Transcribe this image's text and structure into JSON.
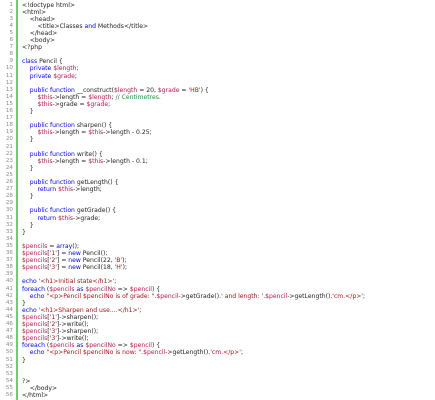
{
  "editor": {
    "lines": [
      {
        "n": "1",
        "parts": [
          [
            "t",
            "<!doctype html>"
          ]
        ]
      },
      {
        "n": "2",
        "parts": [
          [
            "t",
            "<html>"
          ]
        ]
      },
      {
        "n": "3",
        "parts": [
          [
            "t",
            "    <head>"
          ]
        ]
      },
      {
        "n": "4",
        "parts": [
          [
            "t",
            "        <title>Classes "
          ],
          [
            "kw",
            "and"
          ],
          [
            "t",
            " Methods</title>"
          ]
        ]
      },
      {
        "n": "5",
        "parts": [
          [
            "t",
            "    </head>"
          ]
        ]
      },
      {
        "n": "6",
        "parts": [
          [
            "t",
            "    <body>"
          ]
        ]
      },
      {
        "n": "7",
        "parts": [
          [
            "t",
            "<?php"
          ]
        ]
      },
      {
        "n": "8",
        "parts": []
      },
      {
        "n": "9",
        "parts": [
          [
            "kw",
            "class"
          ],
          [
            "t",
            " Pencil {"
          ]
        ]
      },
      {
        "n": "10",
        "parts": [
          [
            "t",
            "    "
          ],
          [
            "kw",
            "private"
          ],
          [
            "t",
            " "
          ],
          [
            "var",
            "$length"
          ],
          [
            "t",
            ";"
          ]
        ]
      },
      {
        "n": "11",
        "parts": [
          [
            "t",
            "    "
          ],
          [
            "kw",
            "private"
          ],
          [
            "t",
            " "
          ],
          [
            "var",
            "$grade"
          ],
          [
            "t",
            ";"
          ]
        ]
      },
      {
        "n": "12",
        "parts": []
      },
      {
        "n": "13",
        "parts": [
          [
            "t",
            "    "
          ],
          [
            "kw",
            "public function"
          ],
          [
            "t",
            " __construct("
          ],
          [
            "var",
            "$length"
          ],
          [
            "t",
            " = 20, "
          ],
          [
            "var",
            "$grade"
          ],
          [
            "t",
            " = "
          ],
          [
            "str",
            "'HB'"
          ],
          [
            "t",
            ") {"
          ]
        ]
      },
      {
        "n": "14",
        "parts": [
          [
            "t",
            "        "
          ],
          [
            "var",
            "$this"
          ],
          [
            "t",
            "->length = "
          ],
          [
            "var",
            "$length"
          ],
          [
            "t",
            "; "
          ],
          [
            "cm",
            "// Centimetres."
          ]
        ]
      },
      {
        "n": "15",
        "parts": [
          [
            "t",
            "        "
          ],
          [
            "var",
            "$this"
          ],
          [
            "t",
            "->grade = "
          ],
          [
            "var",
            "$grade"
          ],
          [
            "t",
            ";"
          ]
        ]
      },
      {
        "n": "16",
        "parts": [
          [
            "t",
            "    }"
          ]
        ]
      },
      {
        "n": "17",
        "parts": []
      },
      {
        "n": "18",
        "parts": [
          [
            "t",
            "    "
          ],
          [
            "kw",
            "public function"
          ],
          [
            "t",
            " sharpen() {"
          ]
        ]
      },
      {
        "n": "19",
        "parts": [
          [
            "t",
            "        "
          ],
          [
            "var",
            "$this"
          ],
          [
            "t",
            "->length = "
          ],
          [
            "var",
            "$this"
          ],
          [
            "t",
            "->length - 0.25;"
          ]
        ]
      },
      {
        "n": "20",
        "parts": [
          [
            "t",
            "    }"
          ]
        ]
      },
      {
        "n": "21",
        "parts": []
      },
      {
        "n": "22",
        "parts": [
          [
            "t",
            "    "
          ],
          [
            "kw",
            "public function"
          ],
          [
            "t",
            " write() {"
          ]
        ]
      },
      {
        "n": "23",
        "parts": [
          [
            "t",
            "        "
          ],
          [
            "var",
            "$this"
          ],
          [
            "t",
            "->length = "
          ],
          [
            "var",
            "$this"
          ],
          [
            "t",
            "->length - 0.1;"
          ]
        ]
      },
      {
        "n": "24",
        "parts": [
          [
            "t",
            "    }"
          ]
        ]
      },
      {
        "n": "25",
        "parts": []
      },
      {
        "n": "26",
        "parts": [
          [
            "t",
            "    "
          ],
          [
            "kw",
            "public function"
          ],
          [
            "t",
            " getLength() {"
          ]
        ]
      },
      {
        "n": "27",
        "parts": [
          [
            "t",
            "        "
          ],
          [
            "kw",
            "return"
          ],
          [
            "t",
            " "
          ],
          [
            "var",
            "$this"
          ],
          [
            "t",
            "->length;"
          ]
        ]
      },
      {
        "n": "28",
        "parts": [
          [
            "t",
            "    }"
          ]
        ]
      },
      {
        "n": "29",
        "parts": []
      },
      {
        "n": "30",
        "parts": [
          [
            "t",
            "    "
          ],
          [
            "kw",
            "public function"
          ],
          [
            "t",
            " getGrade() {"
          ]
        ]
      },
      {
        "n": "31",
        "parts": [
          [
            "t",
            "        "
          ],
          [
            "kw",
            "return"
          ],
          [
            "t",
            " "
          ],
          [
            "var",
            "$this"
          ],
          [
            "t",
            "->grade;"
          ]
        ]
      },
      {
        "n": "32",
        "parts": [
          [
            "t",
            "    }"
          ]
        ]
      },
      {
        "n": "33",
        "parts": [
          [
            "t",
            "}"
          ]
        ]
      },
      {
        "n": "34",
        "parts": []
      },
      {
        "n": "35",
        "parts": [
          [
            "var",
            "$pencils"
          ],
          [
            "t",
            " = "
          ],
          [
            "kw",
            "array"
          ],
          [
            "t",
            "();"
          ]
        ]
      },
      {
        "n": "36",
        "parts": [
          [
            "var",
            "$pencils"
          ],
          [
            "t",
            "["
          ],
          [
            "str",
            "'1'"
          ],
          [
            "t",
            "] = "
          ],
          [
            "kw",
            "new"
          ],
          [
            "t",
            " Pencil();"
          ]
        ]
      },
      {
        "n": "37",
        "parts": [
          [
            "var",
            "$pencils"
          ],
          [
            "t",
            "["
          ],
          [
            "str",
            "'2'"
          ],
          [
            "t",
            "] = "
          ],
          [
            "kw",
            "new"
          ],
          [
            "t",
            " Pencil(22, "
          ],
          [
            "str",
            "'B'"
          ],
          [
            "t",
            ");"
          ]
        ]
      },
      {
        "n": "38",
        "parts": [
          [
            "var",
            "$pencils"
          ],
          [
            "t",
            "["
          ],
          [
            "str",
            "'3'"
          ],
          [
            "t",
            "] = "
          ],
          [
            "kw",
            "new"
          ],
          [
            "t",
            " Pencil(18, "
          ],
          [
            "str",
            "'H'"
          ],
          [
            "t",
            ");"
          ]
        ]
      },
      {
        "n": "39",
        "parts": []
      },
      {
        "n": "40",
        "parts": [
          [
            "kw",
            "echo"
          ],
          [
            "t",
            " "
          ],
          [
            "str",
            "'<h1>Initial state</h1>'"
          ],
          [
            "t",
            ";"
          ]
        ]
      },
      {
        "n": "41",
        "parts": [
          [
            "kw",
            "foreach"
          ],
          [
            "t",
            " ("
          ],
          [
            "var",
            "$pencils"
          ],
          [
            "t",
            " "
          ],
          [
            "kw",
            "as"
          ],
          [
            "t",
            " "
          ],
          [
            "var",
            "$pencilNo"
          ],
          [
            "t",
            " => "
          ],
          [
            "var",
            "$pencil"
          ],
          [
            "t",
            ") {"
          ]
        ]
      },
      {
        "n": "42",
        "parts": [
          [
            "t",
            "    "
          ],
          [
            "kw",
            "echo"
          ],
          [
            "t",
            " "
          ],
          [
            "str",
            "\"<p>Pencil $pencilNo is of grade: \""
          ],
          [
            "t",
            "."
          ],
          [
            "var",
            "$pencil"
          ],
          [
            "t",
            "->getGrade()."
          ],
          [
            "str",
            "' and length: '"
          ],
          [
            "t",
            "."
          ],
          [
            "var",
            "$pencil"
          ],
          [
            "t",
            "->getLength()."
          ],
          [
            "str",
            "'cm.</p>'"
          ],
          [
            "t",
            ";"
          ]
        ]
      },
      {
        "n": "43",
        "parts": [
          [
            "t",
            "}"
          ]
        ]
      },
      {
        "n": "44",
        "parts": [
          [
            "kw",
            "echo"
          ],
          [
            "t",
            " "
          ],
          [
            "str",
            "'<h1>Sharpen and use....</h1>'"
          ],
          [
            "t",
            ";"
          ]
        ]
      },
      {
        "n": "45",
        "parts": [
          [
            "var",
            "$pencils"
          ],
          [
            "t",
            "["
          ],
          [
            "str",
            "'1'"
          ],
          [
            "t",
            "]->sharpen();"
          ]
        ]
      },
      {
        "n": "46",
        "parts": [
          [
            "var",
            "$pencils"
          ],
          [
            "t",
            "["
          ],
          [
            "str",
            "'2'"
          ],
          [
            "t",
            "]->write();"
          ]
        ]
      },
      {
        "n": "47",
        "parts": [
          [
            "var",
            "$pencils"
          ],
          [
            "t",
            "["
          ],
          [
            "str",
            "'3'"
          ],
          [
            "t",
            "]->sharpen();"
          ]
        ]
      },
      {
        "n": "48",
        "parts": [
          [
            "var",
            "$pencils"
          ],
          [
            "t",
            "["
          ],
          [
            "str",
            "'3'"
          ],
          [
            "t",
            "]->write();"
          ]
        ]
      },
      {
        "n": "49",
        "parts": [
          [
            "kw",
            "foreach"
          ],
          [
            "t",
            " ("
          ],
          [
            "var",
            "$pencils"
          ],
          [
            "t",
            " "
          ],
          [
            "kw",
            "as"
          ],
          [
            "t",
            " "
          ],
          [
            "var",
            "$pencilNo"
          ],
          [
            "t",
            " => "
          ],
          [
            "var",
            "$pencil"
          ],
          [
            "t",
            ") {"
          ]
        ]
      },
      {
        "n": "50",
        "parts": [
          [
            "t",
            "    "
          ],
          [
            "kw",
            "echo"
          ],
          [
            "t",
            " "
          ],
          [
            "str",
            "\"<p>Pencil $pencilNo is now: \""
          ],
          [
            "t",
            "."
          ],
          [
            "var",
            "$pencil"
          ],
          [
            "t",
            "->getLength()."
          ],
          [
            "str",
            "'cm.</p>'"
          ],
          [
            "t",
            ";"
          ]
        ]
      },
      {
        "n": "51",
        "parts": [
          [
            "t",
            "}"
          ]
        ]
      },
      {
        "n": "52",
        "parts": []
      },
      {
        "n": "53",
        "parts": []
      },
      {
        "n": "54",
        "parts": [
          [
            "t",
            "?>"
          ]
        ]
      },
      {
        "n": "55",
        "parts": [
          [
            "t",
            "    </body>"
          ]
        ]
      },
      {
        "n": "56",
        "parts": [
          [
            "t",
            "</html>"
          ]
        ]
      }
    ]
  },
  "colors": {
    "keyword": "#0000e6",
    "variable": "#b3184a",
    "string": "#a31515",
    "comment": "#1a8f3a",
    "gutter_marker": "#6ccf6c"
  }
}
